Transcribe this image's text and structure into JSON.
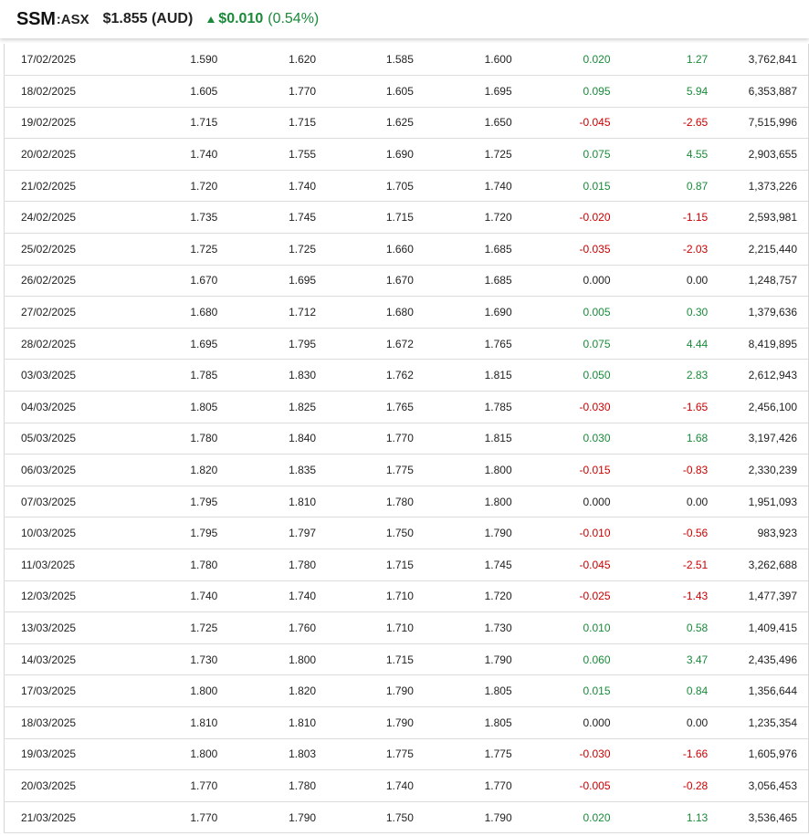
{
  "header": {
    "ticker": "SSM",
    "exchange": ":ASX",
    "price": "$1.855 (AUD)",
    "change_abs": "$0.010",
    "change_pct": "(0.54%)"
  },
  "colors": {
    "positive": "#1a8a3a",
    "negative": "#cc0000",
    "neutral": "#222222"
  },
  "rows": [
    {
      "date": "17/02/2025",
      "open": "1.590",
      "high": "1.620",
      "low": "1.585",
      "close": "1.600",
      "chg": "0.020",
      "pct": "1.27",
      "vol": "3,762,841"
    },
    {
      "date": "18/02/2025",
      "open": "1.605",
      "high": "1.770",
      "low": "1.605",
      "close": "1.695",
      "chg": "0.095",
      "pct": "5.94",
      "vol": "6,353,887"
    },
    {
      "date": "19/02/2025",
      "open": "1.715",
      "high": "1.715",
      "low": "1.625",
      "close": "1.650",
      "chg": "-0.045",
      "pct": "-2.65",
      "vol": "7,515,996"
    },
    {
      "date": "20/02/2025",
      "open": "1.740",
      "high": "1.755",
      "low": "1.690",
      "close": "1.725",
      "chg": "0.075",
      "pct": "4.55",
      "vol": "2,903,655"
    },
    {
      "date": "21/02/2025",
      "open": "1.720",
      "high": "1.740",
      "low": "1.705",
      "close": "1.740",
      "chg": "0.015",
      "pct": "0.87",
      "vol": "1,373,226"
    },
    {
      "date": "24/02/2025",
      "open": "1.735",
      "high": "1.745",
      "low": "1.715",
      "close": "1.720",
      "chg": "-0.020",
      "pct": "-1.15",
      "vol": "2,593,981"
    },
    {
      "date": "25/02/2025",
      "open": "1.725",
      "high": "1.725",
      "low": "1.660",
      "close": "1.685",
      "chg": "-0.035",
      "pct": "-2.03",
      "vol": "2,215,440"
    },
    {
      "date": "26/02/2025",
      "open": "1.670",
      "high": "1.695",
      "low": "1.670",
      "close": "1.685",
      "chg": "0.000",
      "pct": "0.00",
      "vol": "1,248,757"
    },
    {
      "date": "27/02/2025",
      "open": "1.680",
      "high": "1.712",
      "low": "1.680",
      "close": "1.690",
      "chg": "0.005",
      "pct": "0.30",
      "vol": "1,379,636"
    },
    {
      "date": "28/02/2025",
      "open": "1.695",
      "high": "1.795",
      "low": "1.672",
      "close": "1.765",
      "chg": "0.075",
      "pct": "4.44",
      "vol": "8,419,895"
    },
    {
      "date": "03/03/2025",
      "open": "1.785",
      "high": "1.830",
      "low": "1.762",
      "close": "1.815",
      "chg": "0.050",
      "pct": "2.83",
      "vol": "2,612,943"
    },
    {
      "date": "04/03/2025",
      "open": "1.805",
      "high": "1.825",
      "low": "1.765",
      "close": "1.785",
      "chg": "-0.030",
      "pct": "-1.65",
      "vol": "2,456,100"
    },
    {
      "date": "05/03/2025",
      "open": "1.780",
      "high": "1.840",
      "low": "1.770",
      "close": "1.815",
      "chg": "0.030",
      "pct": "1.68",
      "vol": "3,197,426"
    },
    {
      "date": "06/03/2025",
      "open": "1.820",
      "high": "1.835",
      "low": "1.775",
      "close": "1.800",
      "chg": "-0.015",
      "pct": "-0.83",
      "vol": "2,330,239"
    },
    {
      "date": "07/03/2025",
      "open": "1.795",
      "high": "1.810",
      "low": "1.780",
      "close": "1.800",
      "chg": "0.000",
      "pct": "0.00",
      "vol": "1,951,093"
    },
    {
      "date": "10/03/2025",
      "open": "1.795",
      "high": "1.797",
      "low": "1.750",
      "close": "1.790",
      "chg": "-0.010",
      "pct": "-0.56",
      "vol": "983,923"
    },
    {
      "date": "11/03/2025",
      "open": "1.780",
      "high": "1.780",
      "low": "1.715",
      "close": "1.745",
      "chg": "-0.045",
      "pct": "-2.51",
      "vol": "3,262,688"
    },
    {
      "date": "12/03/2025",
      "open": "1.740",
      "high": "1.740",
      "low": "1.710",
      "close": "1.720",
      "chg": "-0.025",
      "pct": "-1.43",
      "vol": "1,477,397"
    },
    {
      "date": "13/03/2025",
      "open": "1.725",
      "high": "1.760",
      "low": "1.710",
      "close": "1.730",
      "chg": "0.010",
      "pct": "0.58",
      "vol": "1,409,415"
    },
    {
      "date": "14/03/2025",
      "open": "1.730",
      "high": "1.800",
      "low": "1.715",
      "close": "1.790",
      "chg": "0.060",
      "pct": "3.47",
      "vol": "2,435,496"
    },
    {
      "date": "17/03/2025",
      "open": "1.800",
      "high": "1.820",
      "low": "1.790",
      "close": "1.805",
      "chg": "0.015",
      "pct": "0.84",
      "vol": "1,356,644"
    },
    {
      "date": "18/03/2025",
      "open": "1.810",
      "high": "1.810",
      "low": "1.790",
      "close": "1.805",
      "chg": "0.000",
      "pct": "0.00",
      "vol": "1,235,354"
    },
    {
      "date": "19/03/2025",
      "open": "1.800",
      "high": "1.803",
      "low": "1.775",
      "close": "1.775",
      "chg": "-0.030",
      "pct": "-1.66",
      "vol": "1,605,976"
    },
    {
      "date": "20/03/2025",
      "open": "1.770",
      "high": "1.780",
      "low": "1.740",
      "close": "1.770",
      "chg": "-0.005",
      "pct": "-0.28",
      "vol": "3,056,453"
    },
    {
      "date": "21/03/2025",
      "open": "1.770",
      "high": "1.790",
      "low": "1.750",
      "close": "1.790",
      "chg": "0.020",
      "pct": "1.13",
      "vol": "3,536,465"
    }
  ]
}
